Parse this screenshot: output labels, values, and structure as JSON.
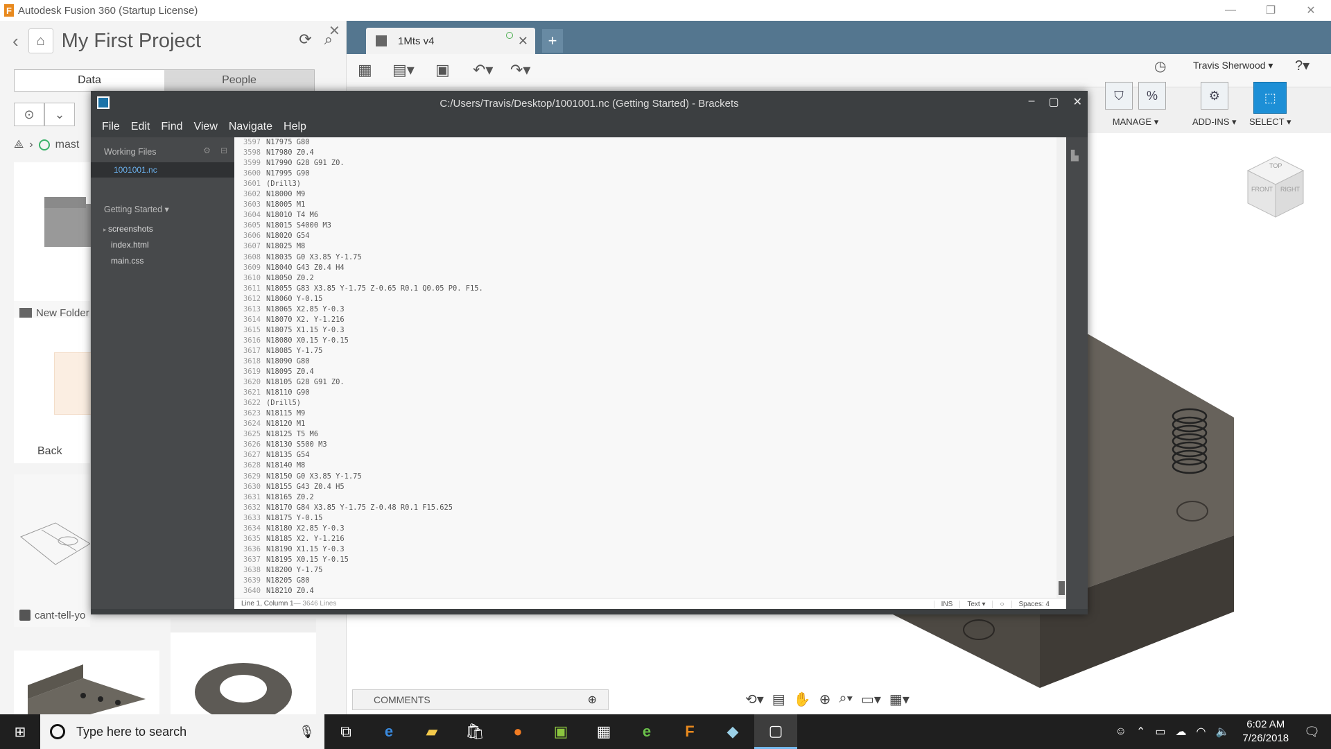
{
  "fusion": {
    "window_title": "Autodesk Fusion 360 (Startup License)",
    "app_logo": "F",
    "win_controls": [
      "—",
      "❐",
      "✕"
    ],
    "data_panel": {
      "back": "‹",
      "project_title": "My First Project",
      "tabs": [
        "Data",
        "People"
      ],
      "breadcrumb_branch": "mast",
      "tiles": [
        {
          "label": "New Folder"
        },
        {
          "label": "Back"
        },
        {
          "label": "cant-tell-yo"
        }
      ]
    },
    "doc_tab": {
      "title": "1Mts v4",
      "new_tab": "+"
    },
    "user_name": "Travis Sherwood ▾",
    "help": "?▾",
    "ribbon": {
      "manage": "MANAGE ▾",
      "addins": "ADD-INS ▾",
      "select": "SELECT ▾"
    },
    "viewcube": {
      "top": "TOP",
      "front": "FRONT",
      "right": "RIGHT"
    },
    "comments": "COMMENTS"
  },
  "brackets": {
    "title": "C:/Users/Travis/Desktop/1001001.nc (Getting Started) - Brackets",
    "win_controls": [
      "–",
      "▢",
      "✕"
    ],
    "menu": [
      "File",
      "Edit",
      "Find",
      "View",
      "Navigate",
      "Help"
    ],
    "sidebar": {
      "working_files": "Working Files",
      "active_file": "1001001.nc",
      "project": "Getting Started ▾",
      "tree": [
        "screenshots",
        "index.html",
        "main.css"
      ]
    },
    "code_lines": [
      {
        "n": "3597",
        "t": "N17975 G80"
      },
      {
        "n": "3598",
        "t": "N17980 Z0.4"
      },
      {
        "n": "3599",
        "t": "N17990 G28 G91 Z0."
      },
      {
        "n": "3600",
        "t": "N17995 G90"
      },
      {
        "n": "3601",
        "t": "(Drill3)"
      },
      {
        "n": "3602",
        "t": "N18000 M9"
      },
      {
        "n": "3603",
        "t": "N18005 M1"
      },
      {
        "n": "3604",
        "t": "N18010 T4 M6"
      },
      {
        "n": "3605",
        "t": "N18015 S4000 M3"
      },
      {
        "n": "3606",
        "t": "N18020 G54"
      },
      {
        "n": "3607",
        "t": "N18025 M8"
      },
      {
        "n": "3608",
        "t": "N18035 G0 X3.85 Y-1.75"
      },
      {
        "n": "3609",
        "t": "N18040 G43 Z0.4 H4"
      },
      {
        "n": "3610",
        "t": "N18050 Z0.2"
      },
      {
        "n": "3611",
        "t": "N18055 G83 X3.85 Y-1.75 Z-0.65 R0.1 Q0.05 P0. F15."
      },
      {
        "n": "3612",
        "t": "N18060 Y-0.15"
      },
      {
        "n": "3613",
        "t": "N18065 X2.85 Y-0.3"
      },
      {
        "n": "3614",
        "t": "N18070 X2. Y-1.216"
      },
      {
        "n": "3615",
        "t": "N18075 X1.15 Y-0.3"
      },
      {
        "n": "3616",
        "t": "N18080 X0.15 Y-0.15"
      },
      {
        "n": "3617",
        "t": "N18085 Y-1.75"
      },
      {
        "n": "3618",
        "t": "N18090 G80"
      },
      {
        "n": "3619",
        "t": "N18095 Z0.4"
      },
      {
        "n": "3620",
        "t": "N18105 G28 G91 Z0."
      },
      {
        "n": "3621",
        "t": "N18110 G90"
      },
      {
        "n": "3622",
        "t": "(Drill5)"
      },
      {
        "n": "3623",
        "t": "N18115 M9"
      },
      {
        "n": "3624",
        "t": "N18120 M1"
      },
      {
        "n": "3625",
        "t": "N18125 T5 M6"
      },
      {
        "n": "3626",
        "t": "N18130 S500 M3"
      },
      {
        "n": "3627",
        "t": "N18135 G54"
      },
      {
        "n": "3628",
        "t": "N18140 M8"
      },
      {
        "n": "3629",
        "t": "N18150 G0 X3.85 Y-1.75"
      },
      {
        "n": "3630",
        "t": "N18155 G43 Z0.4 H5"
      },
      {
        "n": "3631",
        "t": "N18165 Z0.2"
      },
      {
        "n": "3632",
        "t": "N18170 G84 X3.85 Y-1.75 Z-0.48 R0.1 F15.625"
      },
      {
        "n": "3633",
        "t": "N18175 Y-0.15"
      },
      {
        "n": "3634",
        "t": "N18180 X2.85 Y-0.3"
      },
      {
        "n": "3635",
        "t": "N18185 X2. Y-1.216"
      },
      {
        "n": "3636",
        "t": "N18190 X1.15 Y-0.3"
      },
      {
        "n": "3637",
        "t": "N18195 X0.15 Y-0.15"
      },
      {
        "n": "3638",
        "t": "N18200 Y-1.75"
      },
      {
        "n": "3639",
        "t": "N18205 G80"
      },
      {
        "n": "3640",
        "t": "N18210 Z0.4"
      }
    ],
    "status": {
      "cursor": "Line 1, Column 1",
      "lines": " — 3646 Lines",
      "ins": "INS",
      "lang": "Text ▾",
      "spaces": "Spaces: 4"
    }
  },
  "taskbar": {
    "search_placeholder": "Type here to search",
    "time": "6:02 AM",
    "date": "7/26/2018"
  },
  "colors": {
    "fusion_tabbar": "#54768f",
    "brackets_chrome": "#3c3f41",
    "brackets_sidebar": "#47494b",
    "select_accent": "#1d8fd6",
    "taskbar": "#1f1f1f"
  }
}
